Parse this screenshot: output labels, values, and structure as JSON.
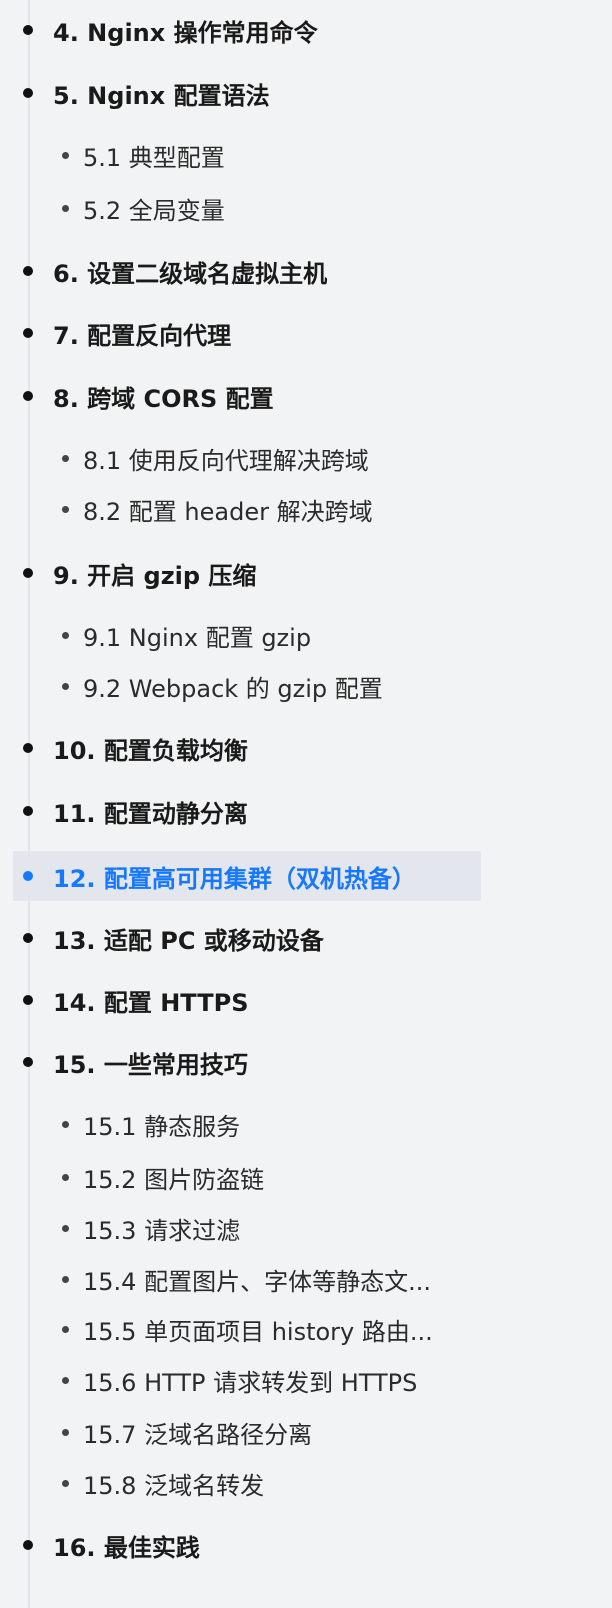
{
  "toc": {
    "items": [
      {
        "label": "4. Nginx 操作常用命令"
      },
      {
        "label": "5. Nginx 配置语法"
      },
      {
        "label": "5.1 典型配置"
      },
      {
        "label": "5.2 全局变量"
      },
      {
        "label": "6. 设置二级域名虚拟主机"
      },
      {
        "label": "7. 配置反向代理"
      },
      {
        "label": "8. 跨域 CORS 配置"
      },
      {
        "label": "8.1 使用反向代理解决跨域"
      },
      {
        "label": "8.2 配置 header 解决跨域"
      },
      {
        "label": "9. 开启 gzip 压缩"
      },
      {
        "label": "9.1 Nginx 配置 gzip"
      },
      {
        "label": "9.2 Webpack 的 gzip 配置"
      },
      {
        "label": "10. 配置负载均衡"
      },
      {
        "label": "11. 配置动静分离"
      },
      {
        "label": "12. 配置高可用集群（双机热备）"
      },
      {
        "label": "13. 适配 PC 或移动设备"
      },
      {
        "label": "14. 配置 HTTPS"
      },
      {
        "label": "15. 一些常用技巧"
      },
      {
        "label": "15.1 静态服务"
      },
      {
        "label": "15.2 图片防盗链"
      },
      {
        "label": "15.3 请求过滤"
      },
      {
        "label": "15.4 配置图片、字体等静态文..."
      },
      {
        "label": "15.5 单页面项目 history 路由..."
      },
      {
        "label": "15.6 HTTP 请求转发到 HTTPS"
      },
      {
        "label": "15.7 泛域名路径分离"
      },
      {
        "label": "15.8 泛域名转发"
      },
      {
        "label": "16. 最佳实践"
      }
    ]
  },
  "colors": {
    "active_accent": "#1677ff",
    "active_background": "#e3e7ed",
    "page_background": "#f2f3f4"
  }
}
